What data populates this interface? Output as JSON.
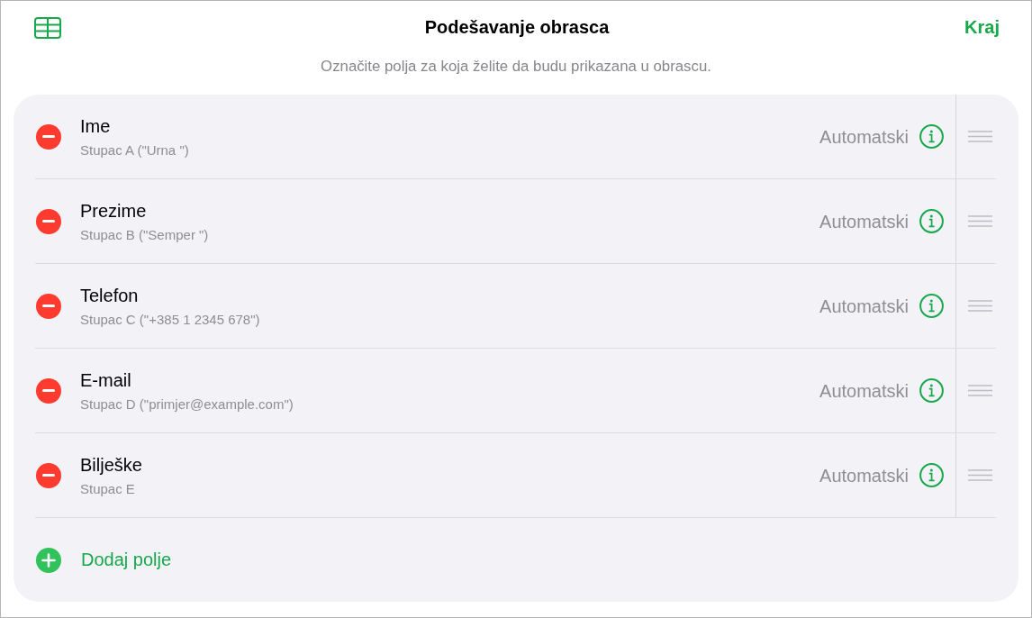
{
  "header": {
    "title": "Podešavanje obrasca",
    "done_button": "Kraj"
  },
  "instructions": "Označite polja za koja želite da budu prikazana u obrascu.",
  "fields": [
    {
      "name": "Ime",
      "source": "Stupac A (\"Urna \")",
      "format": "Automatski"
    },
    {
      "name": "Prezime",
      "source": "Stupac B (\"Semper \")",
      "format": "Automatski"
    },
    {
      "name": "Telefon",
      "source": "Stupac C (\"+385 1 2345 678\")",
      "format": "Automatski"
    },
    {
      "name": "E-mail",
      "source": "Stupac D (\"primjer@example.com\")",
      "format": "Automatski"
    },
    {
      "name": "Bilješke",
      "source": "Stupac E",
      "format": "Automatski"
    }
  ],
  "add_button": "Dodaj polje"
}
